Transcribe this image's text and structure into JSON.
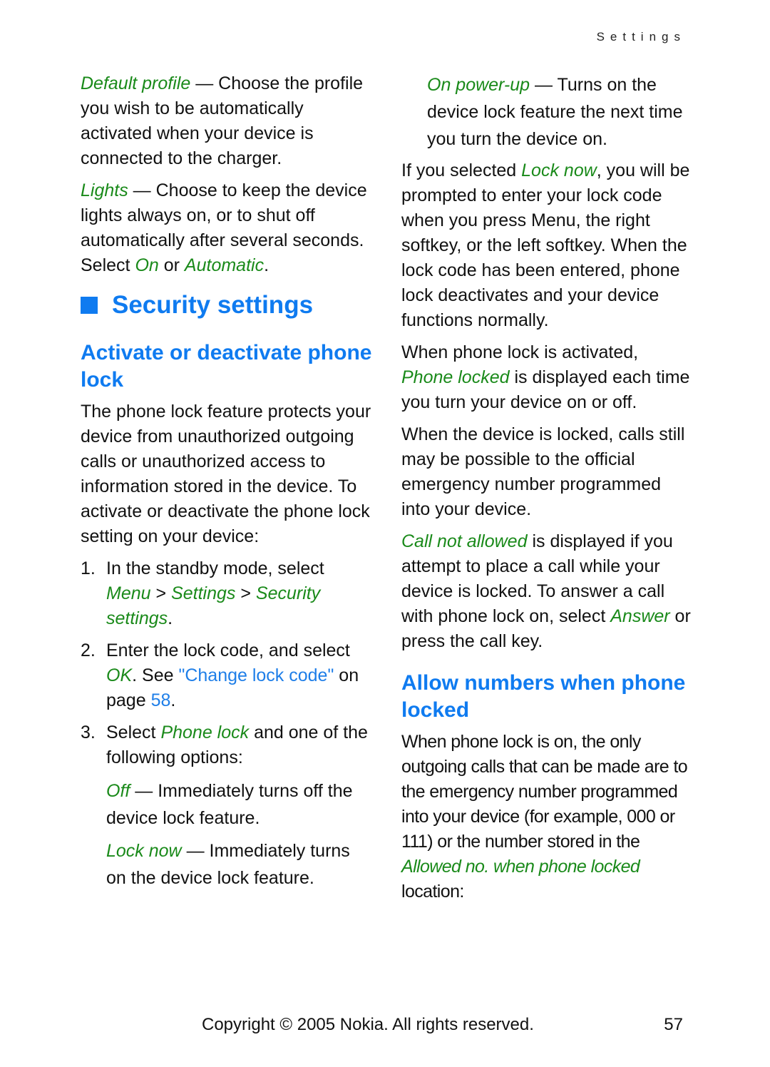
{
  "running_head": "Settings",
  "left": {
    "default_profile": {
      "term": "Default profile",
      "text": " — Choose the profile you wish to be automatically activated when your device is connected to the charger."
    },
    "lights": {
      "term": "Lights",
      "text1": " — Choose to keep the device lights always on, or to shut off automatically after several seconds. Select ",
      "opt1": "On",
      "mid": " or ",
      "opt2": "Automatic",
      "end": "."
    },
    "section_title": "Security settings",
    "subsection_title": "Activate or deactivate phone lock",
    "intro": "The phone lock feature protects your device from unauthorized outgoing calls or unauthorized access to information stored in the device. To activate or deactivate the phone lock setting on your device:",
    "steps": [
      {
        "num": "1.",
        "text": "In the standby mode, select ",
        "menu": "Menu",
        "sep": " > ",
        "settings": "Settings",
        "sec": "Security settings",
        "end": "."
      },
      {
        "num": "2.",
        "text": "Enter the lock code, and select ",
        "ok": "OK",
        "see": ". See ",
        "link": "\"Change lock code\"",
        "on": " on page ",
        "page": "58",
        "end": "."
      },
      {
        "num": "3.",
        "text": "Select ",
        "term": "Phone lock",
        "rest": " and one of the following options:"
      }
    ],
    "options": [
      {
        "term": "Off",
        "text": " — Immediately turns off the device lock feature."
      },
      {
        "term": "Lock now",
        "text": " — Immediately turns on the device lock feature."
      }
    ]
  },
  "right": {
    "power_up": {
      "term": "On power-up",
      "text": " — Turns on the device lock feature the next time you turn the device on."
    },
    "p1": {
      "a": "If you selected ",
      "term": "Lock now",
      "b": ", you will be prompted to enter your lock code when you press Menu, the right softkey, or the left softkey. When the lock code has been entered, phone lock deactivates and your device functions normally."
    },
    "p2": {
      "a": "When phone lock is activated, ",
      "term": "Phone locked",
      "b": " is displayed each time you turn your device on or off."
    },
    "p3": "When the device is locked, calls still may be possible to the official emergency number programmed into your device.",
    "p4": {
      "term": "Call not allowed",
      "a": " is displayed if you attempt to place a call while your device is locked. To answer a call with phone lock on, select ",
      "term2": "Answer",
      "b": " or press the call key."
    },
    "subsection_title": "Allow numbers when phone locked",
    "p5": {
      "a": "When phone lock is on, the only outgoing calls that can be made are to the emergency number programmed into your device (for example, 000 or 111) or the number stored in the ",
      "term": "Allowed no. when phone locked",
      "b": " location:"
    }
  },
  "footer": {
    "copyright": "Copyright © 2005 Nokia. All rights reserved.",
    "page_number": "57"
  }
}
